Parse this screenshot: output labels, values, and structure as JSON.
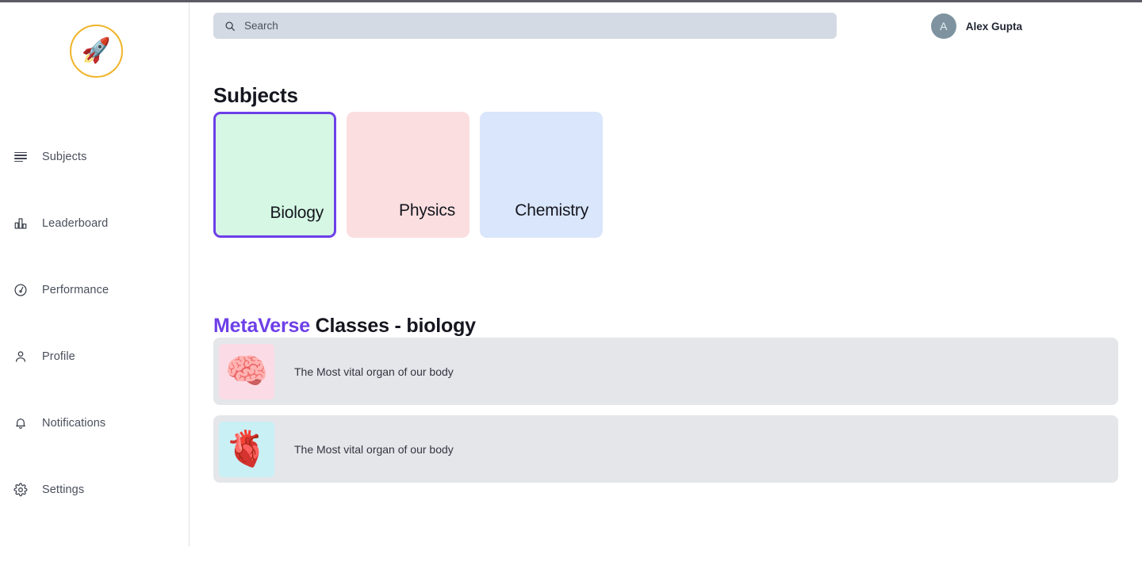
{
  "app": {
    "logo_icon": "rocket-icon",
    "logo_glyph": "🚀",
    "logo_ring_color": "#f0b429"
  },
  "sidebar": {
    "items": [
      {
        "label": "Subjects",
        "icon": "list-lines-icon"
      },
      {
        "label": "Leaderboard",
        "icon": "bar-chart-icon"
      },
      {
        "label": "Performance",
        "icon": "speedometer-icon"
      },
      {
        "label": "Profile",
        "icon": "user-icon"
      },
      {
        "label": "Notifications",
        "icon": "bell-icon"
      },
      {
        "label": "Settings",
        "icon": "gear-icon"
      }
    ]
  },
  "header": {
    "search": {
      "icon": "search-icon",
      "placeholder": "Search",
      "value": ""
    },
    "user": {
      "avatar_initial": "A",
      "avatar_color": "#7e939f",
      "name": "Alex Gupta"
    }
  },
  "main": {
    "subjects_heading": "Subjects",
    "subjects": [
      {
        "label": "Biology",
        "bg": "#d5f7e3",
        "selected": true,
        "border": "#6d3fe8"
      },
      {
        "label": "Physics",
        "bg": "#fbdfe0",
        "selected": false,
        "border": "transparent"
      },
      {
        "label": "Chemistry",
        "bg": "#d9e6fb",
        "selected": false,
        "border": "transparent"
      }
    ],
    "classes_heading": {
      "brand": "MetaVerse",
      "rest": " Classes - biology"
    },
    "classes": [
      {
        "title": "The Most vital organ of our body",
        "thumb_icon": "brain-icon",
        "thumb_glyph": "🧠",
        "thumb_bg": "#fbdce6"
      },
      {
        "title": "The Most vital organ of our body",
        "thumb_icon": "heart-organ-icon",
        "thumb_glyph": "🫀",
        "thumb_bg": "#c9f0f5"
      }
    ]
  }
}
